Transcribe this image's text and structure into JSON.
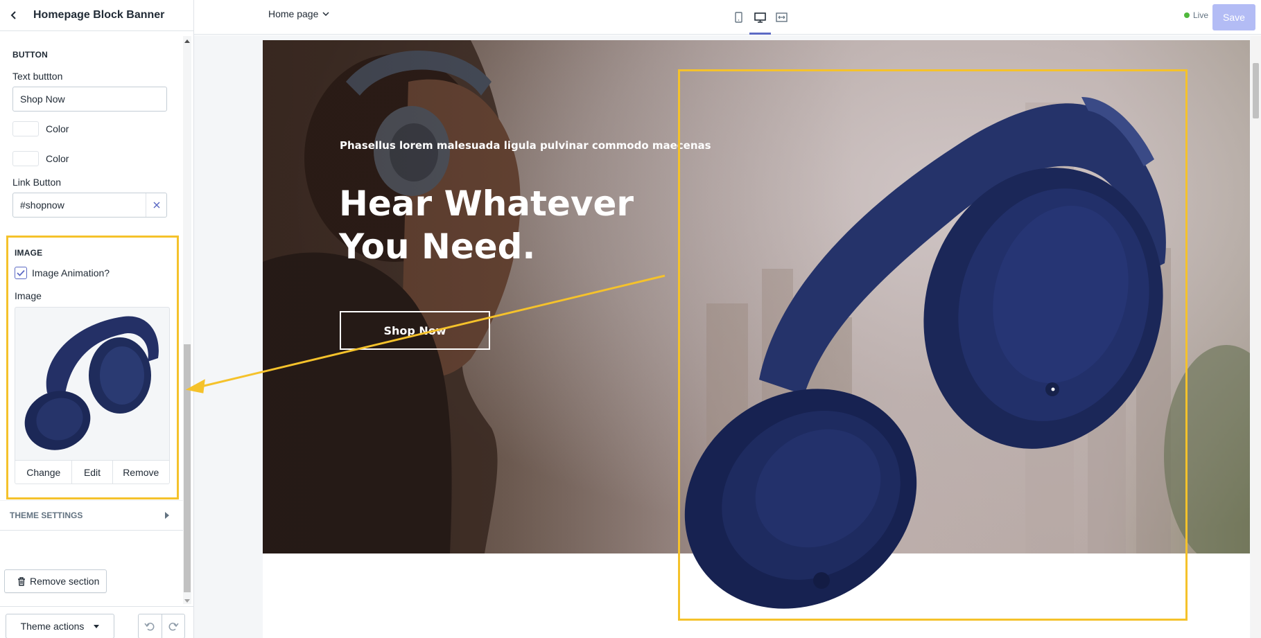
{
  "sidebar": {
    "title": "Homepage Block Banner",
    "button_section": {
      "heading": "BUTTON",
      "text_button_label": "Text buttton",
      "text_button_value": "Shop Now",
      "color_label_1": "Color",
      "color_label_2": "Color",
      "link_button_label": "Link Button",
      "link_button_value": "#shopnow"
    },
    "image_section": {
      "heading": "IMAGE",
      "animation_label": "Image Animation?",
      "animation_checked": true,
      "image_label": "Image",
      "change_label": "Change",
      "edit_label": "Edit",
      "remove_label": "Remove"
    },
    "theme_settings_label": "THEME SETTINGS",
    "remove_section_label": "Remove section",
    "theme_actions_label": "Theme actions"
  },
  "topbar": {
    "page_selector": "Home page",
    "live_label": "Live",
    "save_label": "Save"
  },
  "banner": {
    "subtitle": "Phasellus lorem malesuada ligula pulvinar commodo maecenas",
    "title": "Hear Whatever You Need.",
    "button_label": "Shop Now"
  },
  "colors": {
    "highlight": "#f5c22b",
    "accent": "#5c6ac4",
    "save_disabled": "#b3bcf5",
    "live": "#50b83c",
    "headphone_navy": "#1f2c5c"
  },
  "icons": [
    "back-arrow-icon",
    "close-icon",
    "checkmark-icon",
    "trash-icon",
    "caret-right-icon",
    "caret-down-icon",
    "undo-icon",
    "redo-icon",
    "mobile-icon",
    "desktop-icon",
    "full-width-icon",
    "chevron-down-icon"
  ]
}
